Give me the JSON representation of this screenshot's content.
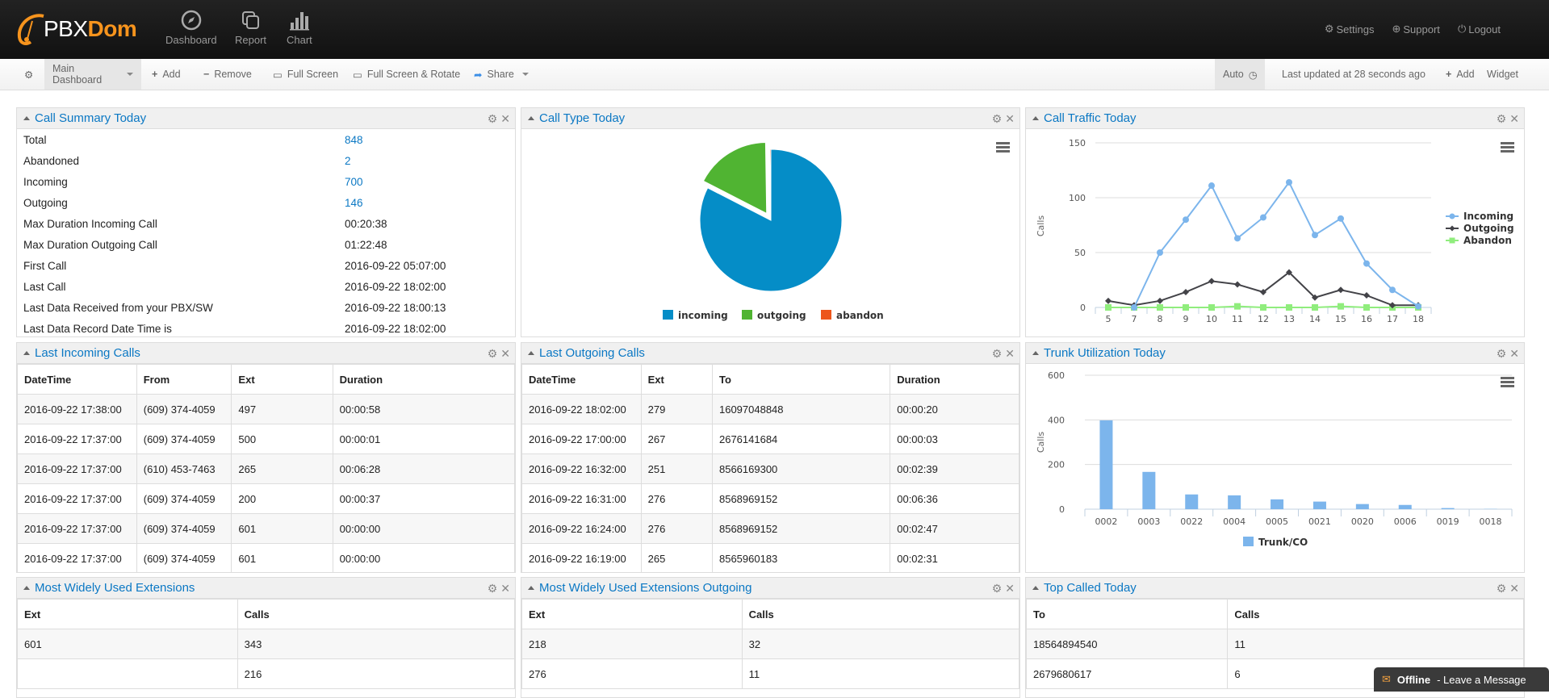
{
  "header": {
    "logo_plain": "PBX",
    "logo_bold": "Dom",
    "nav": [
      {
        "label": "Dashboard",
        "icon": "compass-icon"
      },
      {
        "label": "Report",
        "icon": "copy-icon"
      },
      {
        "label": "Chart",
        "icon": "bar-chart-icon"
      }
    ],
    "right_links": [
      {
        "label": "Settings",
        "icon": "gears-icon"
      },
      {
        "label": "Support",
        "icon": "lifebuoy-icon"
      },
      {
        "label": "Logout",
        "icon": "power-icon"
      }
    ]
  },
  "toolbar": {
    "dashboard_select": "Main Dashboard",
    "add": "Add",
    "remove": "Remove",
    "full_screen": "Full Screen",
    "full_screen_rotate": "Full Screen & Rotate",
    "share": "Share",
    "auto": "Auto",
    "last_updated": "Last updated at 28 seconds ago",
    "add_widget_1": "Add",
    "add_widget_2": "Widget"
  },
  "call_summary": {
    "title": "Call Summary Today",
    "rows": [
      {
        "label": "Total",
        "value": "848"
      },
      {
        "label": "Abandoned",
        "value": "2"
      },
      {
        "label": "Incoming",
        "value": "700"
      },
      {
        "label": "Outgoing",
        "value": "146"
      },
      {
        "label": "Max Duration Incoming Call",
        "value": "00:20:38"
      },
      {
        "label": "Max Duration Outgoing Call",
        "value": "01:22:48"
      },
      {
        "label": "First Call",
        "value": "2016-09-22 05:07:00"
      },
      {
        "label": "Last Call",
        "value": "2016-09-22 18:02:00"
      },
      {
        "label": "Last Data Received from your PBX/SW",
        "value": "2016-09-22 18:00:13"
      },
      {
        "label": "Last Data Record Date Time is",
        "value": "2016-09-22 18:02:00"
      }
    ]
  },
  "call_type": {
    "title": "Call Type Today"
  },
  "call_traffic": {
    "title": "Call Traffic Today"
  },
  "trunk": {
    "title": "Trunk Utilization Today"
  },
  "last_incoming": {
    "title": "Last Incoming Calls",
    "columns": [
      "DateTime",
      "From",
      "Ext",
      "Duration"
    ],
    "rows": [
      [
        "2016-09-22 17:38:00",
        "(609) 374-4059",
        "497",
        "00:00:58"
      ],
      [
        "2016-09-22 17:37:00",
        "(609) 374-4059",
        "500",
        "00:00:01"
      ],
      [
        "2016-09-22 17:37:00",
        "(610) 453-7463",
        "265",
        "00:06:28"
      ],
      [
        "2016-09-22 17:37:00",
        "(609) 374-4059",
        "200",
        "00:00:37"
      ],
      [
        "2016-09-22 17:37:00",
        "(609) 374-4059",
        "601",
        "00:00:00"
      ],
      [
        "2016-09-22 17:37:00",
        "(609) 374-4059",
        "601",
        "00:00:00"
      ]
    ]
  },
  "last_outgoing": {
    "title": "Last Outgoing Calls",
    "columns": [
      "DateTime",
      "Ext",
      "To",
      "Duration"
    ],
    "rows": [
      [
        "2016-09-22 18:02:00",
        "279",
        "16097048848",
        "00:00:20"
      ],
      [
        "2016-09-22 17:00:00",
        "267",
        "2676141684",
        "00:00:03"
      ],
      [
        "2016-09-22 16:32:00",
        "251",
        "8566169300",
        "00:02:39"
      ],
      [
        "2016-09-22 16:31:00",
        "276",
        "8568969152",
        "00:06:36"
      ],
      [
        "2016-09-22 16:24:00",
        "276",
        "8568969152",
        "00:02:47"
      ],
      [
        "2016-09-22 16:19:00",
        "265",
        "8565960183",
        "00:02:31"
      ]
    ]
  },
  "most_used_ext": {
    "title": "Most Widely Used Extensions",
    "columns": [
      "Ext",
      "Calls"
    ],
    "rows": [
      [
        "601",
        "343"
      ],
      [
        "",
        "216"
      ]
    ]
  },
  "most_used_ext_out": {
    "title": "Most Widely Used Extensions Outgoing",
    "columns": [
      "Ext",
      "Calls"
    ],
    "rows": [
      [
        "218",
        "32"
      ],
      [
        "276",
        "11"
      ]
    ]
  },
  "top_called": {
    "title": "Top Called Today",
    "columns": [
      "To",
      "Calls"
    ],
    "rows": [
      [
        "18564894540",
        "11"
      ],
      [
        "2679680617",
        "6"
      ]
    ]
  },
  "chat": {
    "status": "Offline",
    "message": "- Leave a Message"
  },
  "colors": {
    "accent": "#0b78c4",
    "brand": "#f7941d"
  },
  "chart_data": [
    {
      "type": "pie",
      "title": "Call Type Today",
      "categories": [
        "incoming",
        "outgoing",
        "abandon"
      ],
      "values": [
        700,
        146,
        2
      ],
      "colors": [
        "#058dc7",
        "#50b432",
        "#ed561b"
      ],
      "legend": "bottom"
    },
    {
      "type": "line",
      "title": "Call Traffic Today",
      "x": [
        "5",
        "7",
        "8",
        "9",
        "10",
        "11",
        "12",
        "13",
        "14",
        "15",
        "16",
        "17",
        "18"
      ],
      "ylabel": "Calls",
      "ylim": [
        0,
        150
      ],
      "yticks": [
        0,
        50,
        100,
        150
      ],
      "grid": true,
      "legend": "right",
      "series": [
        {
          "name": "Incoming",
          "color": "#7cb5ec",
          "marker": "circle",
          "values": [
            null,
            0,
            50,
            80,
            111,
            63,
            82,
            114,
            66,
            81,
            40,
            16,
            1
          ]
        },
        {
          "name": "Outgoing",
          "color": "#434348",
          "marker": "diamond",
          "values": [
            6,
            2,
            6,
            14,
            24,
            21,
            14,
            32,
            9,
            16,
            11,
            2,
            2
          ]
        },
        {
          "name": "Abandon",
          "color": "#90ed7d",
          "marker": "square",
          "values": [
            0,
            0,
            0,
            0,
            0,
            1,
            0,
            0,
            0,
            1,
            0,
            0,
            0
          ]
        }
      ]
    },
    {
      "type": "bar",
      "title": "Trunk Utilization Today",
      "categories": [
        "0002",
        "0003",
        "0022",
        "0004",
        "0005",
        "0021",
        "0020",
        "0006",
        "0019",
        "0018"
      ],
      "values": [
        398,
        167,
        66,
        62,
        44,
        34,
        23,
        19,
        5,
        1
      ],
      "series_name": "Trunk/CO",
      "color": "#7cb5ec",
      "ylabel": "Calls",
      "ylim": [
        0,
        600
      ],
      "yticks": [
        0,
        200,
        400,
        600
      ],
      "grid": true,
      "legend": "bottom"
    }
  ]
}
